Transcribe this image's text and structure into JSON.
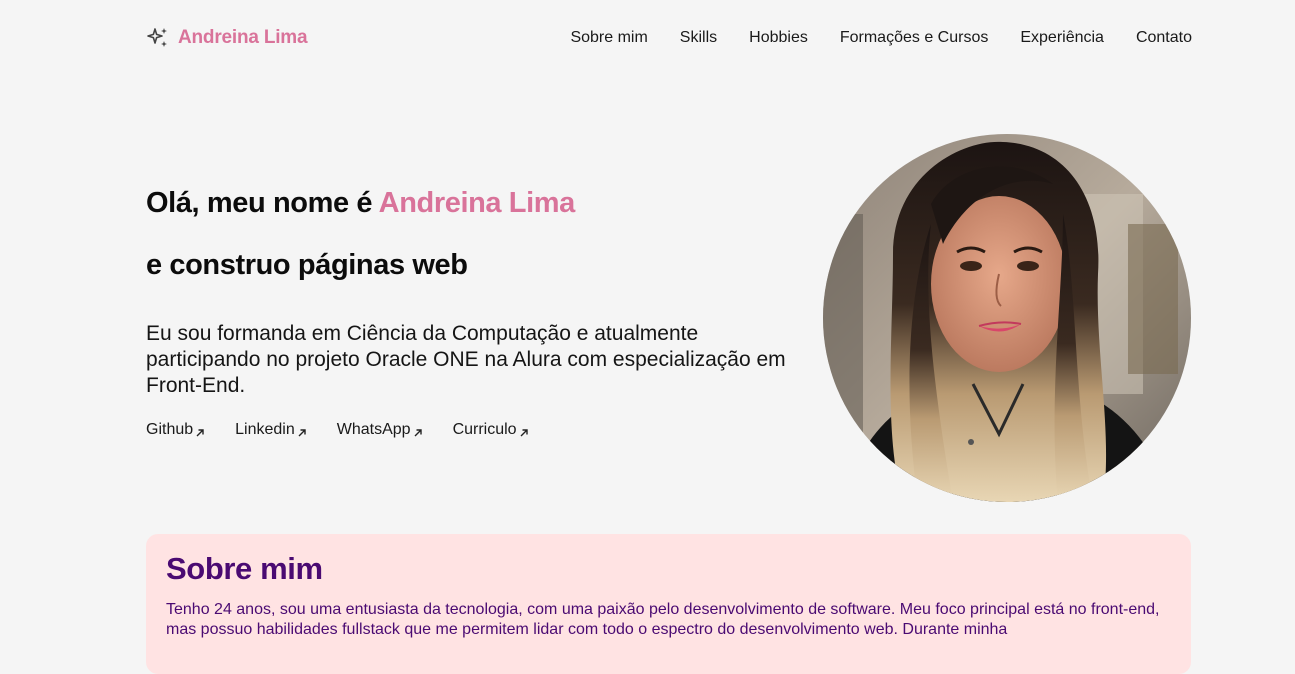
{
  "header": {
    "logo_icon": "sparkles-icon",
    "logo_text": "Andreina Lima",
    "nav": [
      {
        "label": "Sobre mim"
      },
      {
        "label": "Skills"
      },
      {
        "label": "Hobbies"
      },
      {
        "label": "Formações e Cursos"
      },
      {
        "label": "Experiência"
      },
      {
        "label": "Contato"
      }
    ]
  },
  "hero": {
    "greeting_prefix": "Olá, meu nome é ",
    "name": "Andreina Lima",
    "subtitle": "e construo páginas web",
    "description": "Eu sou formanda em Ciência da Computação e atualmente participando no projeto Oracle ONE na Alura com especialização em Front-End.",
    "links": [
      {
        "label": "Github",
        "icon": "arrow-up-right-icon"
      },
      {
        "label": "Linkedin",
        "icon": "arrow-up-right-icon"
      },
      {
        "label": "WhatsApp",
        "icon": "arrow-up-right-icon"
      },
      {
        "label": "Curriculo",
        "icon": "arrow-up-right-icon"
      }
    ]
  },
  "about": {
    "title": "Sobre mim",
    "text": "Tenho 24 anos, sou uma entusiasta da tecnologia, com uma paixão pelo desenvolvimento de software. Meu foco principal está no front-end, mas possuo habilidades fullstack que me permitem lidar com todo o espectro do desenvolvimento web. Durante minha"
  },
  "colors": {
    "accent": "#d9739a",
    "about_bg": "#ffe3e3",
    "about_text": "#4a0a72",
    "page_bg": "#f5f5f5"
  }
}
